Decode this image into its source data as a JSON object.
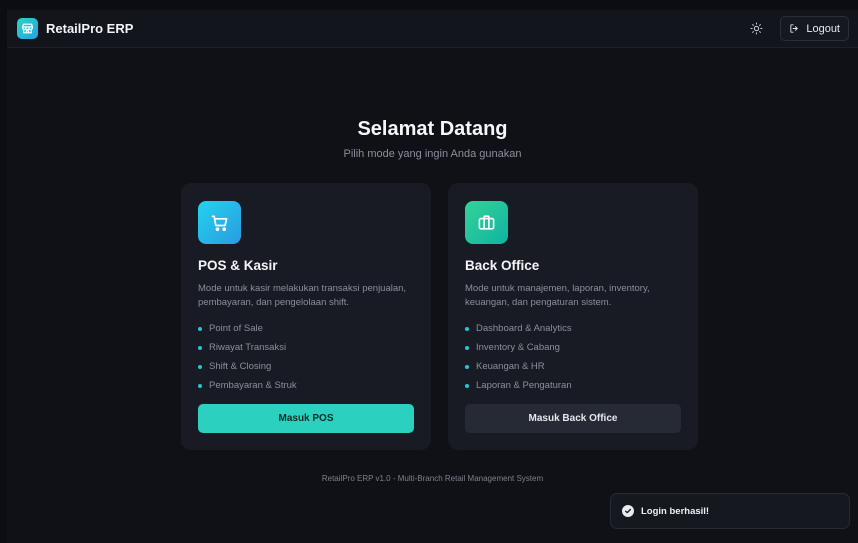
{
  "app": {
    "name": "RetailPro ERP",
    "brand_icon": "store-icon"
  },
  "header": {
    "theme_icon": "sun-icon",
    "logout_label": "Logout",
    "logout_icon": "logout-icon"
  },
  "welcome": {
    "title": "Selamat Datang",
    "subtitle": "Pilih mode yang ingin Anda gunakan"
  },
  "cards": [
    {
      "icon": "shopping-cart-icon",
      "title": "POS & Kasir",
      "description": "Mode untuk kasir melakukan transaksi penjualan, pembayaran, dan pengelolaan shift.",
      "features": [
        "Point of Sale",
        "Riwayat Transaksi",
        "Shift & Closing",
        "Pembayaran & Struk"
      ],
      "button_label": "Masuk POS"
    },
    {
      "icon": "briefcase-icon",
      "title": "Back Office",
      "description": "Mode untuk manajemen, laporan, inventory, keuangan, dan pengaturan sistem.",
      "features": [
        "Dashboard & Analytics",
        "Inventory & Cabang",
        "Keuangan & HR",
        "Laporan & Pengaturan"
      ],
      "button_label": "Masuk Back Office"
    }
  ],
  "footer": {
    "text": "RetailPro ERP v1.0 - Multi-Branch Retail Management System"
  },
  "toast": {
    "message": "Login berhasil!",
    "icon": "check-circle-icon"
  },
  "colors": {
    "accent": "#2bd1be",
    "background": "#0f1117",
    "card": "#181b23"
  }
}
